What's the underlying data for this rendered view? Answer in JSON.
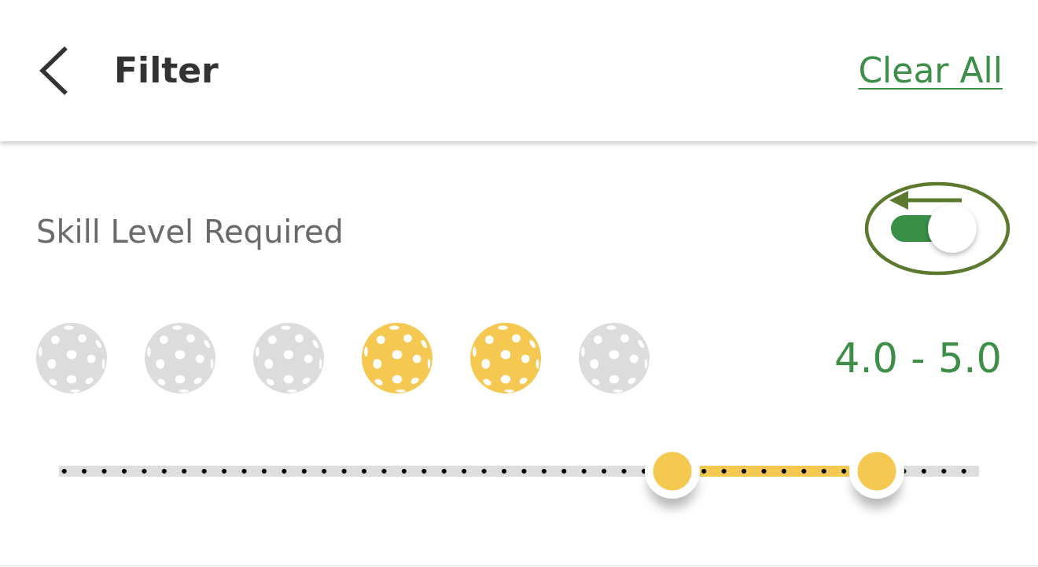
{
  "header": {
    "title": "Filter",
    "clear_action": "Clear All"
  },
  "skill_level": {
    "label": "Skill Level Required",
    "toggle_on": true,
    "balls": [
      {
        "selected": false
      },
      {
        "selected": false
      },
      {
        "selected": false
      },
      {
        "selected": true
      },
      {
        "selected": true
      },
      {
        "selected": false
      }
    ],
    "range_label": "4.0 - 5.0",
    "slider": {
      "thumbs": [
        {
          "level": 0.667
        },
        {
          "level": 0.889
        }
      ]
    }
  }
}
